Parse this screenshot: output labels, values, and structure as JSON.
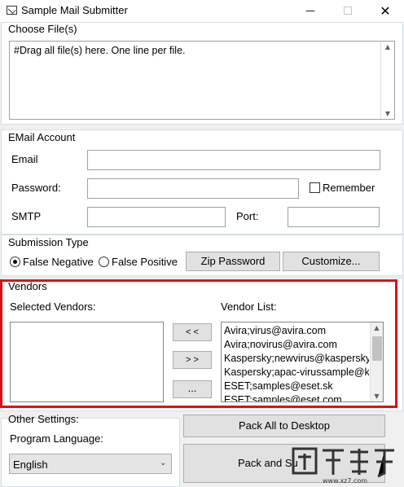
{
  "window": {
    "title": "Sample Mail Submitter",
    "minimize": "—",
    "close": "✕"
  },
  "choose_files": {
    "label": "Choose File(s)",
    "text": "#Drag all file(s) here. One line per file."
  },
  "email_account": {
    "label": "EMail Account",
    "email_label": "Email",
    "email_value": "",
    "password_label": "Password:",
    "password_value": "",
    "remember_label": "Remember",
    "remember_checked": false,
    "smtp_label": "SMTP",
    "smtp_value": "",
    "port_label": "Port:",
    "port_value": ""
  },
  "submission_type": {
    "label": "Submission Type",
    "false_negative": "False Negative",
    "false_positive": "False Positive",
    "selected": "False Negative",
    "zip_password_btn": "Zip Password",
    "customize_btn": "Customize..."
  },
  "vendors": {
    "label": "Vendors",
    "selected_label": "Selected Vendors:",
    "vendor_list_label": "Vendor List:",
    "move_left_btn": "< <",
    "move_right_btn": "> >",
    "more_btn": "...",
    "selected_items": [],
    "vendor_list": [
      "Avira;virus@avira.com",
      "Avira;novirus@avira.com",
      "Kaspersky;newvirus@kaspersky.com",
      "Kaspersky;apac-virussample@kaspersky.com",
      "ESET;samples@eset.sk",
      "ESET;samples@eset.com"
    ]
  },
  "other_settings": {
    "label": "Other Settings:",
    "language_label": "Program Language:",
    "language_value": "English",
    "pack_desktop_btn": "Pack All to Desktop",
    "pack_send_btn": "Pack and Su"
  },
  "colors": {
    "highlight": "#e01010",
    "window_bg": "#f0f0f0",
    "button_bg": "#e1e1e1"
  }
}
